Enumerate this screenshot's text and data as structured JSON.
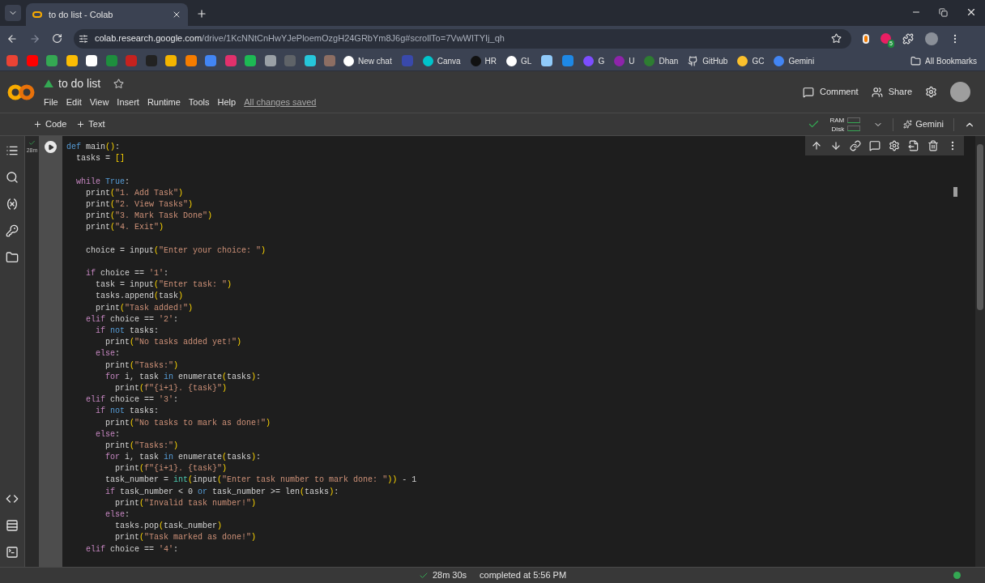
{
  "browser": {
    "tab": {
      "title": "to do list - Colab"
    },
    "address": {
      "host": "colab.research.google.com",
      "path": "/drive/1KcNNtCnHwYJePloemOzgH24GRbYm8J6g#scrollTo=7VwWITYIj_qh"
    },
    "extension_badge": "5",
    "bookmarks": [
      {
        "label": "New chat"
      },
      {
        "label": "Canva"
      },
      {
        "label": "HR"
      },
      {
        "label": "GL"
      },
      {
        "label": "G"
      },
      {
        "label": "U"
      },
      {
        "label": "Dhan"
      },
      {
        "label": "GitHub"
      },
      {
        "label": "GC"
      },
      {
        "label": "Gemini"
      }
    ],
    "all_bookmarks": "All Bookmarks"
  },
  "notebook": {
    "title": "to do list",
    "menu": [
      "File",
      "Edit",
      "View",
      "Insert",
      "Runtime",
      "Tools",
      "Help"
    ],
    "save_status": "All changes saved",
    "actions": [
      "Comment",
      "Share"
    ]
  },
  "toolbar": {
    "insert": [
      "Code",
      "Text"
    ],
    "resources": [
      "RAM",
      "Disk"
    ],
    "gemini": "Gemini"
  },
  "cell": {
    "exec_time": "28m",
    "lines": [
      {
        "kind": "code",
        "tokens": [
          {
            "text": "def",
            "kind": "constant"
          },
          {
            "text": " main",
            "kind": "plain"
          },
          {
            "text": "()",
            "kind": "bracket"
          },
          {
            "text": ":",
            "kind": "plain"
          }
        ]
      },
      {
        "kind": "code",
        "tokens": [
          {
            "text": "  tasks = ",
            "kind": "plain"
          },
          {
            "text": "[]",
            "kind": "bracket"
          }
        ]
      },
      {
        "kind": "blank"
      },
      {
        "kind": "code",
        "tokens": [
          {
            "text": "  while",
            "kind": "keyword"
          },
          {
            "text": " True",
            "kind": "constant"
          },
          {
            "text": ":",
            "kind": "plain"
          }
        ]
      },
      {
        "kind": "code",
        "tokens": [
          {
            "text": "    print",
            "kind": "plain"
          },
          {
            "text": "(",
            "kind": "bracket"
          },
          {
            "text": "\"1. Add Task\"",
            "kind": "string"
          },
          {
            "text": ")",
            "kind": "bracket"
          }
        ]
      },
      {
        "kind": "code",
        "tokens": [
          {
            "text": "    print",
            "kind": "plain"
          },
          {
            "text": "(",
            "kind": "bracket"
          },
          {
            "text": "\"2. View Tasks\"",
            "kind": "string"
          },
          {
            "text": ")",
            "kind": "bracket"
          }
        ]
      },
      {
        "kind": "code",
        "tokens": [
          {
            "text": "    print",
            "kind": "plain"
          },
          {
            "text": "(",
            "kind": "bracket"
          },
          {
            "text": "\"3. Mark Task Done\"",
            "kind": "string"
          },
          {
            "text": ")",
            "kind": "bracket"
          }
        ]
      },
      {
        "kind": "code",
        "tokens": [
          {
            "text": "    print",
            "kind": "plain"
          },
          {
            "text": "(",
            "kind": "bracket"
          },
          {
            "text": "\"4. Exit\"",
            "kind": "string"
          },
          {
            "text": ")",
            "kind": "bracket"
          }
        ]
      },
      {
        "kind": "blank"
      },
      {
        "kind": "code",
        "tokens": [
          {
            "text": "    choice = input",
            "kind": "plain"
          },
          {
            "text": "(",
            "kind": "bracket"
          },
          {
            "text": "\"Enter your choice: \"",
            "kind": "string"
          },
          {
            "text": ")",
            "kind": "bracket"
          }
        ]
      },
      {
        "kind": "blank"
      },
      {
        "kind": "code",
        "tokens": [
          {
            "text": "    if",
            "kind": "keyword"
          },
          {
            "text": " choice == ",
            "kind": "plain"
          },
          {
            "text": "'1'",
            "kind": "string"
          },
          {
            "text": ":",
            "kind": "plain"
          }
        ]
      },
      {
        "kind": "code",
        "tokens": [
          {
            "text": "      task = input",
            "kind": "plain"
          },
          {
            "text": "(",
            "kind": "bracket"
          },
          {
            "text": "\"Enter task: \"",
            "kind": "string"
          },
          {
            "text": ")",
            "kind": "bracket"
          }
        ]
      },
      {
        "kind": "code",
        "tokens": [
          {
            "text": "      tasks.append",
            "kind": "plain"
          },
          {
            "text": "(",
            "kind": "bracket"
          },
          {
            "text": "task",
            "kind": "plain"
          },
          {
            "text": ")",
            "kind": "bracket"
          }
        ]
      },
      {
        "kind": "code",
        "tokens": [
          {
            "text": "      print",
            "kind": "plain"
          },
          {
            "text": "(",
            "kind": "bracket"
          },
          {
            "text": "\"Task added!\"",
            "kind": "string"
          },
          {
            "text": ")",
            "kind": "bracket"
          }
        ]
      },
      {
        "kind": "code",
        "tokens": [
          {
            "text": "    elif",
            "kind": "keyword"
          },
          {
            "text": " choice == ",
            "kind": "plain"
          },
          {
            "text": "'2'",
            "kind": "string"
          },
          {
            "text": ":",
            "kind": "plain"
          }
        ]
      },
      {
        "kind": "code",
        "tokens": [
          {
            "text": "      if",
            "kind": "keyword"
          },
          {
            "text": " not",
            "kind": "constant"
          },
          {
            "text": " tasks:",
            "kind": "plain"
          }
        ]
      },
      {
        "kind": "code",
        "tokens": [
          {
            "text": "        print",
            "kind": "plain"
          },
          {
            "text": "(",
            "kind": "bracket"
          },
          {
            "text": "\"No tasks added yet!\"",
            "kind": "string"
          },
          {
            "text": ")",
            "kind": "bracket"
          }
        ]
      },
      {
        "kind": "code",
        "tokens": [
          {
            "text": "      else",
            "kind": "keyword"
          },
          {
            "text": ":",
            "kind": "plain"
          }
        ]
      },
      {
        "kind": "code",
        "tokens": [
          {
            "text": "        print",
            "kind": "plain"
          },
          {
            "text": "(",
            "kind": "bracket"
          },
          {
            "text": "\"Tasks:\"",
            "kind": "string"
          },
          {
            "text": ")",
            "kind": "bracket"
          }
        ]
      },
      {
        "kind": "code",
        "tokens": [
          {
            "text": "        for",
            "kind": "keyword"
          },
          {
            "text": " i, task ",
            "kind": "plain"
          },
          {
            "text": "in",
            "kind": "constant"
          },
          {
            "text": " enumerate",
            "kind": "plain"
          },
          {
            "text": "(",
            "kind": "bracket"
          },
          {
            "text": "tasks",
            "kind": "plain"
          },
          {
            "text": ")",
            "kind": "bracket"
          },
          {
            "text": ":",
            "kind": "plain"
          }
        ]
      },
      {
        "kind": "code",
        "tokens": [
          {
            "text": "          print",
            "kind": "plain"
          },
          {
            "text": "(",
            "kind": "bracket"
          },
          {
            "text": "f\"{i+1}. {task}\"",
            "kind": "string"
          },
          {
            "text": ")",
            "kind": "bracket"
          }
        ]
      },
      {
        "kind": "code",
        "tokens": [
          {
            "text": "    elif",
            "kind": "keyword"
          },
          {
            "text": " choice == ",
            "kind": "plain"
          },
          {
            "text": "'3'",
            "kind": "string"
          },
          {
            "text": ":",
            "kind": "plain"
          }
        ]
      },
      {
        "kind": "code",
        "tokens": [
          {
            "text": "      if",
            "kind": "keyword"
          },
          {
            "text": " not",
            "kind": "constant"
          },
          {
            "text": " tasks:",
            "kind": "plain"
          }
        ]
      },
      {
        "kind": "code",
        "tokens": [
          {
            "text": "        print",
            "kind": "plain"
          },
          {
            "text": "(",
            "kind": "bracket"
          },
          {
            "text": "\"No tasks to mark as done!\"",
            "kind": "string"
          },
          {
            "text": ")",
            "kind": "bracket"
          }
        ]
      },
      {
        "kind": "code",
        "tokens": [
          {
            "text": "      else",
            "kind": "keyword"
          },
          {
            "text": ":",
            "kind": "plain"
          }
        ]
      },
      {
        "kind": "code",
        "tokens": [
          {
            "text": "        print",
            "kind": "plain"
          },
          {
            "text": "(",
            "kind": "bracket"
          },
          {
            "text": "\"Tasks:\"",
            "kind": "string"
          },
          {
            "text": ")",
            "kind": "bracket"
          }
        ]
      },
      {
        "kind": "code",
        "tokens": [
          {
            "text": "        for",
            "kind": "keyword"
          },
          {
            "text": " i, task ",
            "kind": "plain"
          },
          {
            "text": "in",
            "kind": "constant"
          },
          {
            "text": " enumerate",
            "kind": "plain"
          },
          {
            "text": "(",
            "kind": "bracket"
          },
          {
            "text": "tasks",
            "kind": "plain"
          },
          {
            "text": ")",
            "kind": "bracket"
          },
          {
            "text": ":",
            "kind": "plain"
          }
        ]
      },
      {
        "kind": "code",
        "tokens": [
          {
            "text": "          print",
            "kind": "plain"
          },
          {
            "text": "(",
            "kind": "bracket"
          },
          {
            "text": "f\"{i+1}. {task}\"",
            "kind": "string"
          },
          {
            "text": ")",
            "kind": "bracket"
          }
        ]
      },
      {
        "kind": "code",
        "tokens": [
          {
            "text": "        task_number = ",
            "kind": "plain"
          },
          {
            "text": "int",
            "kind": "builtin"
          },
          {
            "text": "(",
            "kind": "bracket"
          },
          {
            "text": "input",
            "kind": "plain"
          },
          {
            "text": "(",
            "kind": "bracket"
          },
          {
            "text": "\"Enter task number to mark done: \"",
            "kind": "string"
          },
          {
            "text": "))",
            "kind": "bracket"
          },
          {
            "text": " - 1",
            "kind": "plain"
          }
        ]
      },
      {
        "kind": "code",
        "tokens": [
          {
            "text": "        if",
            "kind": "keyword"
          },
          {
            "text": " task_number < 0 ",
            "kind": "plain"
          },
          {
            "text": "or",
            "kind": "constant"
          },
          {
            "text": " task_number >= len",
            "kind": "plain"
          },
          {
            "text": "(",
            "kind": "bracket"
          },
          {
            "text": "tasks",
            "kind": "plain"
          },
          {
            "text": ")",
            "kind": "bracket"
          },
          {
            "text": ":",
            "kind": "plain"
          }
        ]
      },
      {
        "kind": "code",
        "tokens": [
          {
            "text": "          print",
            "kind": "plain"
          },
          {
            "text": "(",
            "kind": "bracket"
          },
          {
            "text": "\"Invalid task number!\"",
            "kind": "string"
          },
          {
            "text": ")",
            "kind": "bracket"
          }
        ]
      },
      {
        "kind": "code",
        "tokens": [
          {
            "text": "        else",
            "kind": "keyword"
          },
          {
            "text": ":",
            "kind": "plain"
          }
        ]
      },
      {
        "kind": "code",
        "tokens": [
          {
            "text": "          tasks.pop",
            "kind": "plain"
          },
          {
            "text": "(",
            "kind": "bracket"
          },
          {
            "text": "task_number",
            "kind": "plain"
          },
          {
            "text": ")",
            "kind": "bracket"
          }
        ]
      },
      {
        "kind": "code",
        "tokens": [
          {
            "text": "          print",
            "kind": "plain"
          },
          {
            "text": "(",
            "kind": "bracket"
          },
          {
            "text": "\"Task marked as done!\"",
            "kind": "string"
          },
          {
            "text": ")",
            "kind": "bracket"
          }
        ]
      },
      {
        "kind": "code",
        "tokens": [
          {
            "text": "    elif",
            "kind": "keyword"
          },
          {
            "text": " choice == ",
            "kind": "plain"
          },
          {
            "text": "'4'",
            "kind": "string"
          },
          {
            "text": ":",
            "kind": "plain"
          }
        ]
      }
    ]
  },
  "status_bar": {
    "duration": "28m 30s",
    "completed": "completed at 5:56 PM"
  }
}
